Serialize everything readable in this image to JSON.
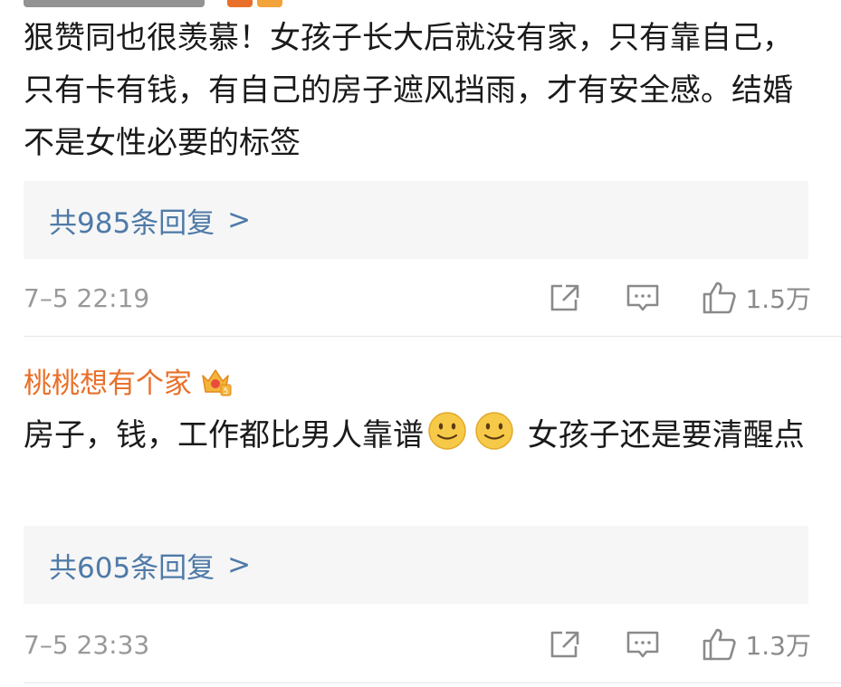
{
  "comments": [
    {
      "text": "狠赞同也很羡慕！女孩子长大后就没有家，只有靠自己，只有卡有钱，有自己的房子遮风挡雨，才有安全感。结婚不是女性必要的标签",
      "reply_label": "共985条回复",
      "reply_chevron": ">",
      "time": "7–5 22:19",
      "likes": "1.5万"
    },
    {
      "username": "桃桃想有个家",
      "text_before": "房子，钱，工作都比男人靠谱",
      "text_after": " 女孩子还是要清醒点",
      "reply_label": "共605条回复",
      "reply_chevron": ">",
      "time": "7–5 23:33",
      "likes": "1.3万"
    }
  ],
  "colors": {
    "username": "#e8702a",
    "reply_link": "#4e7aa8",
    "reply_bg": "#f6f6f6",
    "meta_text": "#999999"
  },
  "icons": [
    "share-icon",
    "comment-icon",
    "like-icon",
    "vip-crown-badge-icon",
    "smile-emoji-icon"
  ]
}
